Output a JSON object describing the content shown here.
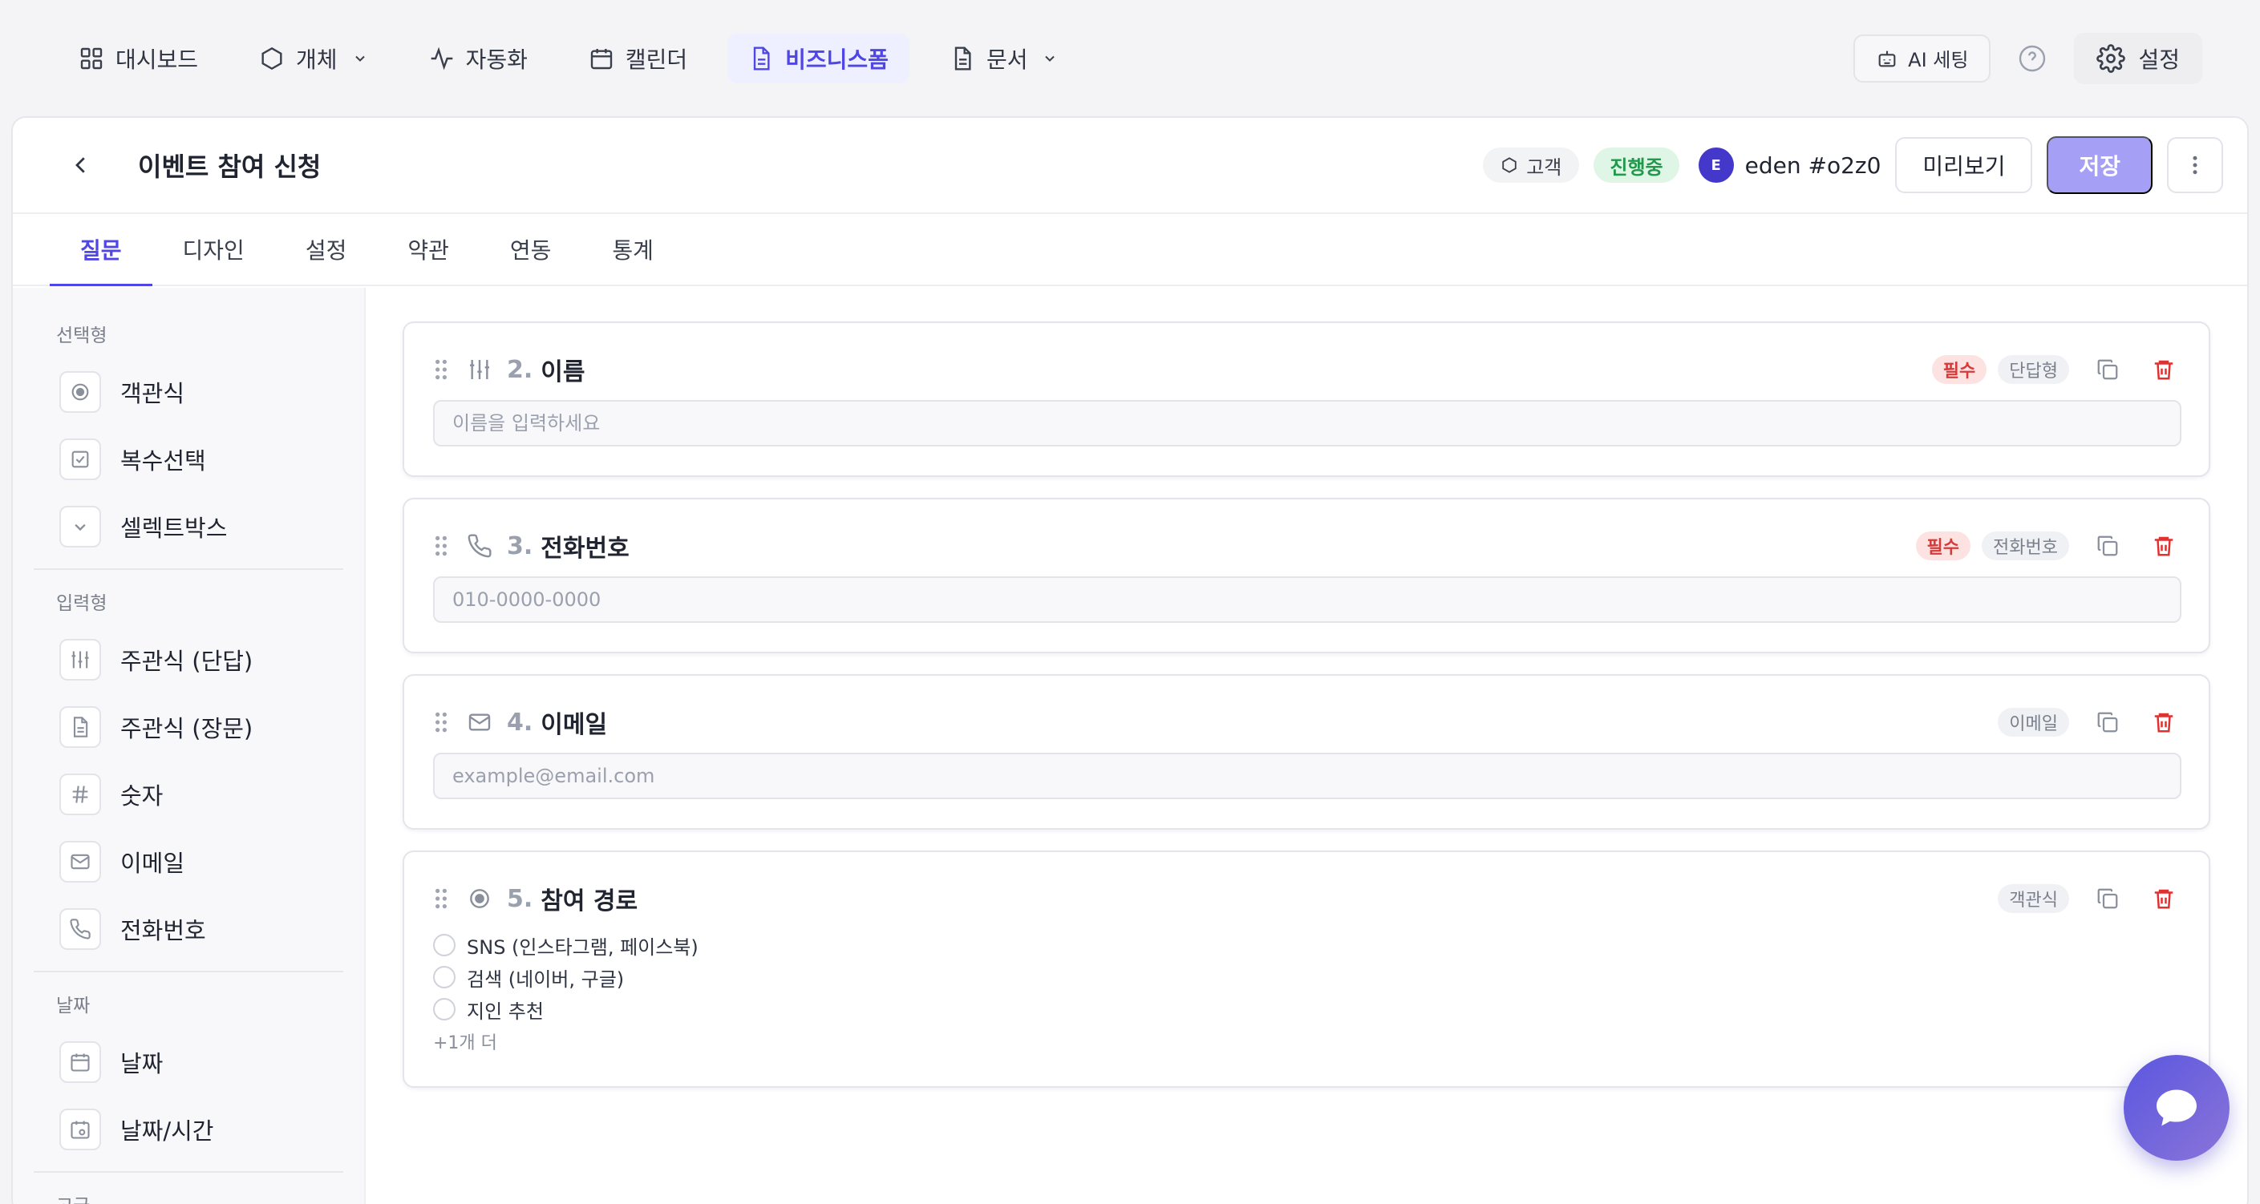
{
  "topnav": {
    "items": [
      {
        "label": "대시보드",
        "icon": "grid-icon",
        "has_dropdown": false,
        "active": false
      },
      {
        "label": "개체",
        "icon": "hexagon-icon",
        "has_dropdown": true,
        "active": false
      },
      {
        "label": "자동화",
        "icon": "activity-icon",
        "has_dropdown": false,
        "active": false
      },
      {
        "label": "캘린더",
        "icon": "calendar-icon",
        "has_dropdown": false,
        "active": false
      },
      {
        "label": "비즈니스폼",
        "icon": "document-icon",
        "has_dropdown": false,
        "active": true
      },
      {
        "label": "문서",
        "icon": "document-icon",
        "has_dropdown": true,
        "active": false
      }
    ],
    "ai_settings_label": "AI 세팅",
    "settings_label": "설정"
  },
  "form": {
    "title": "이벤트 참여 신청",
    "customer_tag": "고객",
    "status": "진행중",
    "user_initial": "E",
    "user_name": "eden #o2z0",
    "preview_label": "미리보기",
    "save_label": "저장"
  },
  "tabs": [
    {
      "label": "질문",
      "active": true
    },
    {
      "label": "디자인",
      "active": false
    },
    {
      "label": "설정",
      "active": false
    },
    {
      "label": "약관",
      "active": false
    },
    {
      "label": "연동",
      "active": false
    },
    {
      "label": "통계",
      "active": false
    }
  ],
  "sidebar": {
    "sections": [
      {
        "heading": "선택형",
        "items": [
          {
            "label": "객관식",
            "icon": "radio-icon"
          },
          {
            "label": "복수선택",
            "icon": "checkbox-icon"
          },
          {
            "label": "셀렉트박스",
            "icon": "chevron-down-icon"
          }
        ]
      },
      {
        "heading": "입력형",
        "items": [
          {
            "label": "주관식 (단답)",
            "icon": "sliders-icon"
          },
          {
            "label": "주관식 (장문)",
            "icon": "document-icon"
          },
          {
            "label": "숫자",
            "icon": "hash-icon"
          },
          {
            "label": "이메일",
            "icon": "mail-icon"
          },
          {
            "label": "전화번호",
            "icon": "phone-icon"
          }
        ]
      },
      {
        "heading": "날짜",
        "items": [
          {
            "label": "날짜",
            "icon": "calendar-icon"
          },
          {
            "label": "날짜/시간",
            "icon": "calendar-clock-icon"
          }
        ]
      },
      {
        "heading": "고급",
        "items": []
      }
    ]
  },
  "questions": [
    {
      "num": "2.",
      "title": "이름",
      "icon": "sliders-icon",
      "required": "필수",
      "type": "단답형",
      "kind": "input",
      "placeholder": "이름을 입력하세요"
    },
    {
      "num": "3.",
      "title": "전화번호",
      "icon": "phone-icon",
      "required": "필수",
      "type": "전화번호",
      "kind": "input",
      "placeholder": "010-0000-0000"
    },
    {
      "num": "4.",
      "title": "이메일",
      "icon": "mail-icon",
      "required": "",
      "type": "이메일",
      "kind": "input",
      "placeholder": "example@email.com"
    },
    {
      "num": "5.",
      "title": "참여 경로",
      "icon": "radio-icon",
      "required": "",
      "type": "객관식",
      "kind": "options",
      "options": [
        "SNS (인스타그램, 페이스북)",
        "검색 (네이버, 구글)",
        "지인 추천"
      ],
      "more": "+1개 더"
    }
  ],
  "colors": {
    "accent": "#4f46e5",
    "save": "#a5a0f5",
    "status_green": "#1e9a4a",
    "required_red": "#d63a3a",
    "delete_red": "#e03131"
  }
}
